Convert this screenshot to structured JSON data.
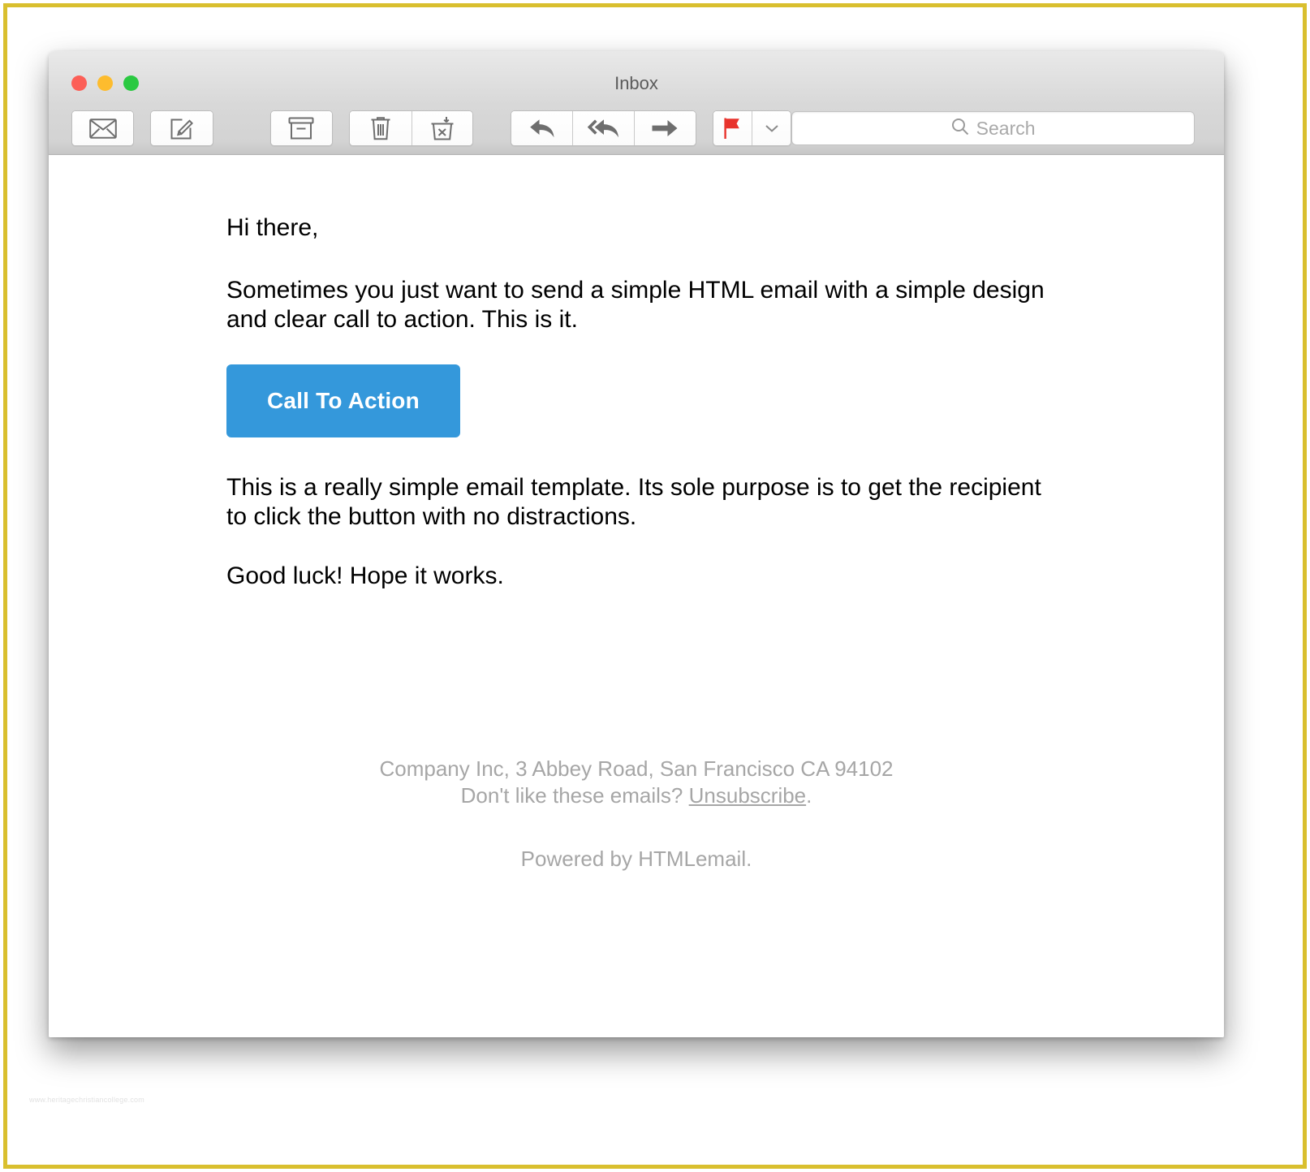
{
  "window": {
    "title": "Inbox",
    "traffic_lights": [
      {
        "name": "close",
        "color": "#fc5f57"
      },
      {
        "name": "minimize",
        "color": "#fdbc2e"
      },
      {
        "name": "zoom",
        "color": "#2bc942"
      }
    ]
  },
  "toolbar": {
    "buttons": [
      {
        "name": "get-mail",
        "icon": "envelope-icon",
        "label": "Get Mail"
      },
      {
        "name": "compose",
        "icon": "compose-pencil-icon",
        "label": "New Message"
      },
      {
        "name": "archive",
        "icon": "archive-box-icon",
        "label": "Archive"
      },
      {
        "name": "delete",
        "icon": "trash-icon",
        "label": "Delete"
      },
      {
        "name": "junk",
        "icon": "junk-mail-icon",
        "label": "Junk"
      },
      {
        "name": "reply",
        "icon": "reply-arrow-icon",
        "label": "Reply"
      },
      {
        "name": "reply-all",
        "icon": "reply-all-arrow-icon",
        "label": "Reply All"
      },
      {
        "name": "forward",
        "icon": "forward-arrow-icon",
        "label": "Forward"
      },
      {
        "name": "flag",
        "icon": "flag-icon",
        "label": "Flag"
      },
      {
        "name": "flag-menu",
        "icon": "chevron-down-icon",
        "label": "Flag Options"
      }
    ],
    "flag_color": "#e8322b"
  },
  "search": {
    "placeholder": "Search",
    "value": "",
    "icon": "search-icon"
  },
  "email": {
    "greeting": "Hi there,",
    "paragraph_1": "Sometimes you just want to send a simple HTML email with a simple design and clear call to action. This is it.",
    "cta_label": "Call To Action",
    "cta_color": "#3498db",
    "paragraph_2": "This is a really simple email template. Its sole purpose is to get the recipient to click the button with no distractions.",
    "paragraph_3": "Good luck! Hope it works."
  },
  "footer": {
    "address": "Company Inc, 3 Abbey Road, San Francisco CA 94102",
    "unsubscribe_prefix": "Don't like these emails? ",
    "unsubscribe_label": "Unsubscribe",
    "unsubscribe_suffix": ".",
    "powered_by": "Powered by HTMLemail."
  },
  "page": {
    "border_color": "#d9bf2e",
    "watermark": "www.heritagechristiancollege.com"
  }
}
